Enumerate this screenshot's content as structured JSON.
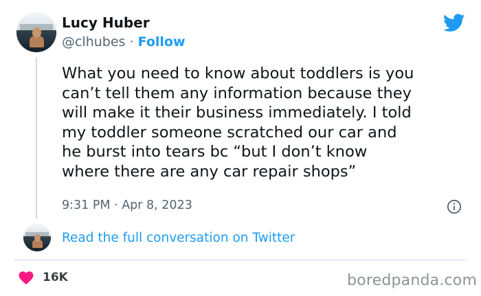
{
  "author": {
    "name": "Lucy Huber",
    "handle": "@clhubes",
    "separator": "·",
    "follow_label": "Follow"
  },
  "tweet": {
    "text": "What you need to know about toddlers is you\ncan’t tell them any information because they\nwill make it their business immediately. I told\nmy toddler someone scratched our car and\nhe burst into tears bc “but I don’t know\nwhere there are any car repair shops”",
    "timestamp": "9:31 PM · Apr 8, 2023"
  },
  "conversation": {
    "link_label": "Read the full conversation on Twitter"
  },
  "engagement": {
    "likes": "16K"
  },
  "watermark": "boredpanda.com",
  "icons": {
    "platform": "twitter-bird-icon",
    "info": "info-icon",
    "like": "heart-icon"
  },
  "colors": {
    "accent": "#1d9bf0",
    "like": "#f91880",
    "muted_text": "#536471"
  }
}
